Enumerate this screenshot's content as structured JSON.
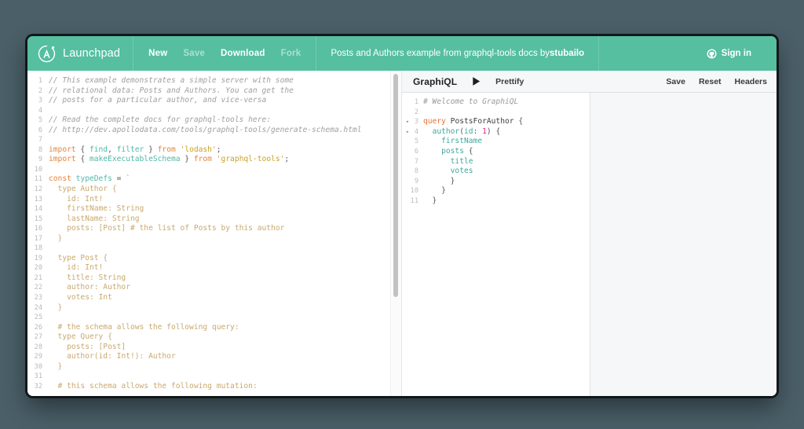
{
  "header": {
    "brand": "Launchpad",
    "logo_icon": "apollo-logo-icon",
    "menu": [
      {
        "label": "New",
        "state": "active"
      },
      {
        "label": "Save",
        "state": "muted"
      },
      {
        "label": "Download",
        "state": "active"
      },
      {
        "label": "Fork",
        "state": "muted"
      }
    ],
    "doc_title_prefix": "Posts and Authors example from graphql-tools docs by ",
    "doc_title_author": "stubailo",
    "signin_label": "Sign in",
    "signin_icon": "github-icon",
    "bg_color": "#55bfa0"
  },
  "code_editor": {
    "name": "server-code-editor",
    "lines": [
      {
        "n": "1",
        "tokens": [
          {
            "t": "com",
            "s": "// This example demonstrates a simple server with some"
          }
        ]
      },
      {
        "n": "2",
        "tokens": [
          {
            "t": "com",
            "s": "// relational data: Posts and Authors. You can get the"
          }
        ]
      },
      {
        "n": "3",
        "tokens": [
          {
            "t": "com",
            "s": "// posts for a particular author, and vice-versa"
          }
        ]
      },
      {
        "n": "4",
        "tokens": [
          {
            "t": "plain",
            "s": ""
          }
        ]
      },
      {
        "n": "5",
        "tokens": [
          {
            "t": "com",
            "s": "// Read the complete docs for graphql-tools here:"
          }
        ]
      },
      {
        "n": "6",
        "tokens": [
          {
            "t": "com",
            "s": "// http://dev.apollodata.com/tools/graphql-tools/generate-schema.html"
          }
        ]
      },
      {
        "n": "7",
        "tokens": [
          {
            "t": "plain",
            "s": ""
          }
        ]
      },
      {
        "n": "8",
        "tokens": [
          {
            "t": "kw",
            "s": "import"
          },
          {
            "t": "pun",
            "s": " { "
          },
          {
            "t": "def",
            "s": "find"
          },
          {
            "t": "pun",
            "s": ", "
          },
          {
            "t": "def",
            "s": "filter"
          },
          {
            "t": "pun",
            "s": " } "
          },
          {
            "t": "kw",
            "s": "from"
          },
          {
            "t": "plain",
            "s": " "
          },
          {
            "t": "str",
            "s": "'lodash'"
          },
          {
            "t": "pun",
            "s": ";"
          }
        ]
      },
      {
        "n": "9",
        "tokens": [
          {
            "t": "kw",
            "s": "import"
          },
          {
            "t": "pun",
            "s": " { "
          },
          {
            "t": "def",
            "s": "makeExecutableSchema"
          },
          {
            "t": "pun",
            "s": " } "
          },
          {
            "t": "kw",
            "s": "from"
          },
          {
            "t": "plain",
            "s": " "
          },
          {
            "t": "str",
            "s": "'graphql-tools'"
          },
          {
            "t": "pun",
            "s": ";"
          }
        ]
      },
      {
        "n": "10",
        "tokens": [
          {
            "t": "plain",
            "s": ""
          }
        ]
      },
      {
        "n": "11",
        "tokens": [
          {
            "t": "kw",
            "s": "const"
          },
          {
            "t": "plain",
            "s": " "
          },
          {
            "t": "def",
            "s": "typeDefs"
          },
          {
            "t": "pun",
            "s": " = "
          },
          {
            "t": "str",
            "s": "`"
          }
        ]
      },
      {
        "n": "12",
        "tokens": [
          {
            "t": "gql",
            "s": "  type Author {"
          }
        ]
      },
      {
        "n": "13",
        "tokens": [
          {
            "t": "gql",
            "s": "    id: Int!"
          }
        ]
      },
      {
        "n": "14",
        "tokens": [
          {
            "t": "gql",
            "s": "    firstName: String"
          }
        ]
      },
      {
        "n": "15",
        "tokens": [
          {
            "t": "gql",
            "s": "    lastName: String"
          }
        ]
      },
      {
        "n": "16",
        "tokens": [
          {
            "t": "gql",
            "s": "    posts: [Post] # the list of Posts by this author"
          }
        ]
      },
      {
        "n": "17",
        "tokens": [
          {
            "t": "gql",
            "s": "  }"
          }
        ]
      },
      {
        "n": "18",
        "tokens": [
          {
            "t": "plain",
            "s": ""
          }
        ]
      },
      {
        "n": "19",
        "tokens": [
          {
            "t": "gql",
            "s": "  type Post {"
          }
        ]
      },
      {
        "n": "20",
        "tokens": [
          {
            "t": "gql",
            "s": "    id: Int!"
          }
        ]
      },
      {
        "n": "21",
        "tokens": [
          {
            "t": "gql",
            "s": "    title: String"
          }
        ]
      },
      {
        "n": "22",
        "tokens": [
          {
            "t": "gql",
            "s": "    author: Author"
          }
        ]
      },
      {
        "n": "23",
        "tokens": [
          {
            "t": "gql",
            "s": "    votes: Int"
          }
        ]
      },
      {
        "n": "24",
        "tokens": [
          {
            "t": "gql",
            "s": "  }"
          }
        ]
      },
      {
        "n": "25",
        "tokens": [
          {
            "t": "plain",
            "s": ""
          }
        ]
      },
      {
        "n": "26",
        "tokens": [
          {
            "t": "gql",
            "s": "  # the schema allows the following query:"
          }
        ]
      },
      {
        "n": "27",
        "tokens": [
          {
            "t": "gql",
            "s": "  type Query {"
          }
        ]
      },
      {
        "n": "28",
        "tokens": [
          {
            "t": "gql",
            "s": "    posts: [Post]"
          }
        ]
      },
      {
        "n": "29",
        "tokens": [
          {
            "t": "gql",
            "s": "    author(id: Int!): Author"
          }
        ]
      },
      {
        "n": "30",
        "tokens": [
          {
            "t": "gql",
            "s": "  }"
          }
        ]
      },
      {
        "n": "31",
        "tokens": [
          {
            "t": "plain",
            "s": ""
          }
        ]
      },
      {
        "n": "32",
        "tokens": [
          {
            "t": "gql",
            "s": "  # this schema allows the following mutation:"
          }
        ]
      }
    ]
  },
  "graphiql": {
    "logo": "GraphiQL",
    "play_icon": "play-icon",
    "prettify_label": "Prettify",
    "save_label": "Save",
    "reset_label": "Reset",
    "headers_label": "Headers",
    "query_lines": [
      {
        "n": "1",
        "fold": "",
        "tokens": [
          {
            "t": "com",
            "s": "# Welcome to GraphiQL"
          }
        ]
      },
      {
        "n": "2",
        "fold": "",
        "tokens": [
          {
            "t": "pun",
            "s": ""
          }
        ]
      },
      {
        "n": "3",
        "fold": "▾",
        "tokens": [
          {
            "t": "kw",
            "s": "query"
          },
          {
            "t": "pun",
            "s": " "
          },
          {
            "t": "name",
            "s": "PostsForAuthor"
          },
          {
            "t": "pun",
            "s": " {"
          }
        ]
      },
      {
        "n": "4",
        "fold": "▾",
        "tokens": [
          {
            "t": "pun",
            "s": "  "
          },
          {
            "t": "fld",
            "s": "author"
          },
          {
            "t": "pun",
            "s": "("
          },
          {
            "t": "arg",
            "s": "id"
          },
          {
            "t": "pun",
            "s": ": "
          },
          {
            "t": "num",
            "s": "1"
          },
          {
            "t": "pun",
            "s": ") {"
          }
        ]
      },
      {
        "n": "5",
        "fold": "",
        "tokens": [
          {
            "t": "pun",
            "s": "    "
          },
          {
            "t": "fld",
            "s": "firstName"
          }
        ]
      },
      {
        "n": "6",
        "fold": "",
        "tokens": [
          {
            "t": "pun",
            "s": "    "
          },
          {
            "t": "fld",
            "s": "posts"
          },
          {
            "t": "pun",
            "s": " {"
          }
        ]
      },
      {
        "n": "7",
        "fold": "",
        "tokens": [
          {
            "t": "pun",
            "s": "      "
          },
          {
            "t": "fld",
            "s": "title"
          }
        ]
      },
      {
        "n": "8",
        "fold": "",
        "tokens": [
          {
            "t": "pun",
            "s": "      "
          },
          {
            "t": "fld",
            "s": "votes"
          }
        ]
      },
      {
        "n": "9",
        "fold": "",
        "tokens": [
          {
            "t": "pun",
            "s": "      }"
          }
        ]
      },
      {
        "n": "10",
        "fold": "",
        "tokens": [
          {
            "t": "pun",
            "s": "    }"
          }
        ]
      },
      {
        "n": "11",
        "fold": "",
        "tokens": [
          {
            "t": "pun",
            "s": "  }"
          }
        ]
      }
    ]
  }
}
